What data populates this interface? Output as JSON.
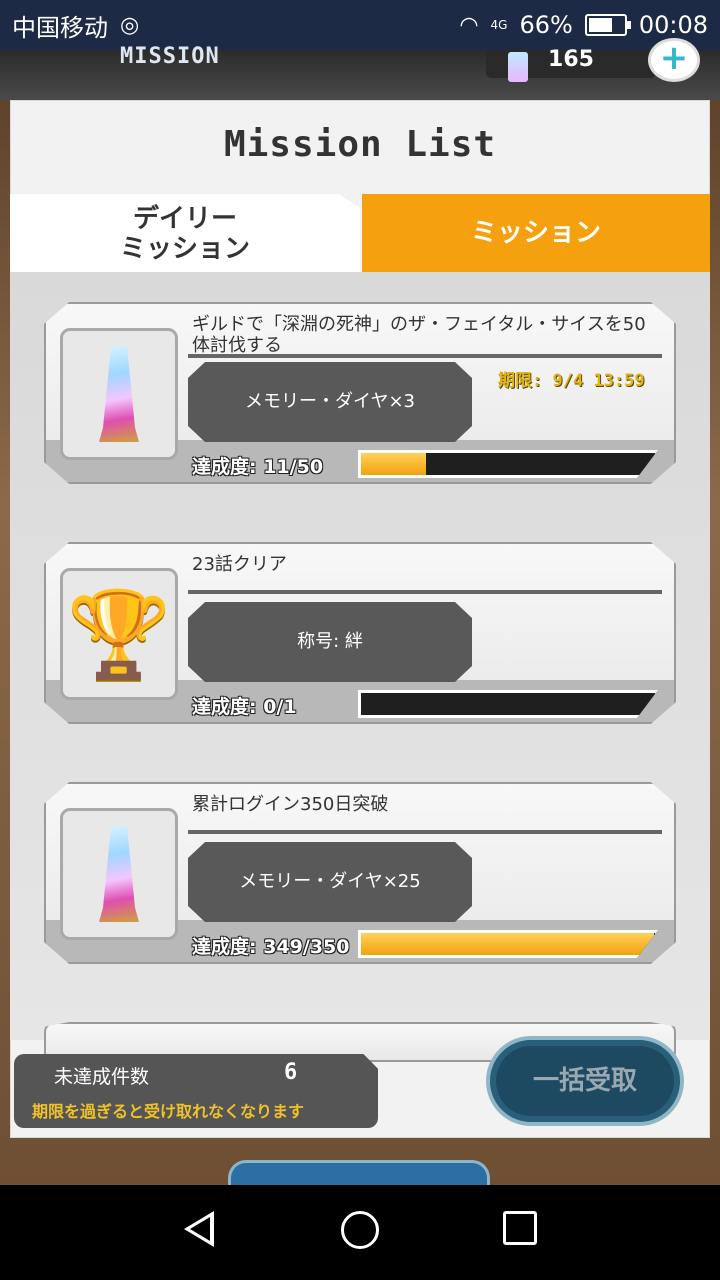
{
  "status_bar": {
    "carrier": "中国移动",
    "network": "4G",
    "battery": "66%",
    "time": "00:08"
  },
  "header": {
    "screen_label": "MISSION",
    "gem_count": "165"
  },
  "panel": {
    "title": "Mission List",
    "tabs": [
      {
        "label": "デイリー\nミッション",
        "active": false
      },
      {
        "label": "ミッション",
        "active": true
      }
    ]
  },
  "missions": [
    {
      "name": "ギルドで「深淵の死神」のザ・フェイタル・サイスを50体討伐する",
      "reward": "メモリー・ダイヤ×3",
      "deadline": "期限: 9/4 13:59",
      "progress_text": "達成度: 11/50",
      "progress_ratio": 0.22,
      "icon": "memory-diamond-icon"
    },
    {
      "name": "23話クリア",
      "reward": "称号: 絆",
      "deadline": "",
      "progress_text": "達成度: 0/1",
      "progress_ratio": 0,
      "icon": "trophy-icon"
    },
    {
      "name": "累計ログイン350日突破",
      "reward": "メモリー・ダイヤ×25",
      "deadline": "",
      "progress_text": "達成度: 349/350",
      "progress_ratio": 0.997,
      "icon": "memory-diamond-icon"
    }
  ],
  "footer": {
    "pending_label": "未達成件数",
    "pending_count": "6",
    "expiry_note": "期限を過ぎると受け取れなくなります",
    "claim_all_label": "一括受取"
  },
  "colors": {
    "accent": "#f5a00e",
    "status_bar": "#1d2a45",
    "reward_box": "#595959"
  }
}
